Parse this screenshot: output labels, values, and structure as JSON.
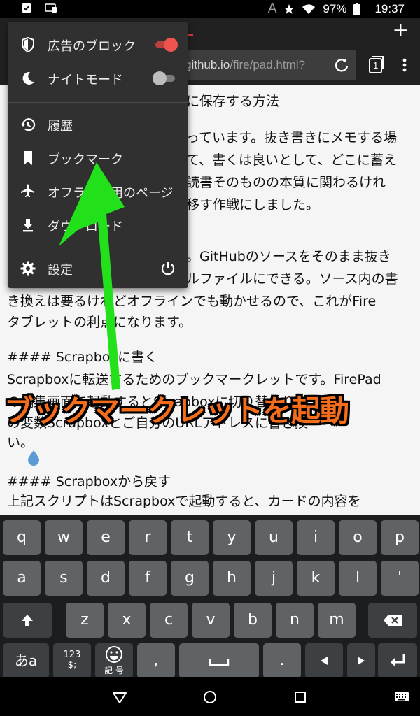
{
  "status": {
    "battery": "97%",
    "time": "19:37",
    "a_indicator": "A"
  },
  "browser": {
    "new_tab_label": "+",
    "url_main": "github.io",
    "url_path": "/fire/pad.html?",
    "tab_count": "1",
    "accent": "#e53935"
  },
  "menu": {
    "items": [
      {
        "label": "広告のブロック",
        "icon": "shield-icon",
        "toggle": "on"
      },
      {
        "label": "ナイトモード",
        "icon": "moon-icon",
        "toggle": "off"
      },
      {
        "label": "履歴",
        "icon": "history-icon"
      },
      {
        "label": "ブックマーク",
        "icon": "bookmark-icon"
      },
      {
        "label": "オフライン用のページ",
        "icon": "airplane-icon"
      },
      {
        "label": "ダウンロード",
        "icon": "download-icon"
      },
      {
        "label": "設定",
        "icon": "gear-icon"
      }
    ],
    "toggle_on_color": "#ef5350"
  },
  "page": {
    "lines": [
      "に保存する方法",
      "っています。抜き書きにメモする場",
      "て、書くは良いとして、どこに蓄え",
      "読書そのものの本質に関わるけれ",
      "移す作戦にしました。",
      "。GitHubのソースをそのまま抜き",
      "ルファイルにできる。ソース内の書",
      "き換えは要るけれどオフラインでも動かせるので、これがFire",
      "タブレットの利点になります。",
      "#### Scrapboxに書く",
      "Scrapboxに転送するためのブックマークレットです。FirePad",
      "の編集画面で起動するとScrapboxに切り替わり",
      "の変数Scrapboxとご自分のURLアドレスに書き換",
      "い。",
      "#### Scrapboxから戻す",
      "上記スクリプトはScrapboxで起動すると、カードの内容を"
    ]
  },
  "annotation": {
    "text": "ブックマークレットを起動",
    "arrow_color": "#22e11b"
  },
  "keyboard": {
    "row1": [
      "q",
      "w",
      "e",
      "r",
      "t",
      "y",
      "u",
      "i",
      "o",
      "p"
    ],
    "row2": [
      "a",
      "s",
      "d",
      "f",
      "g",
      "h",
      "j",
      "k",
      "l",
      "'"
    ],
    "row3": [
      "z",
      "x",
      "c",
      "v",
      "b",
      "n",
      "m"
    ],
    "row4": {
      "lang": "あa",
      "num_top": "123",
      "num_bottom": "$;",
      "emoji_label": "記 号",
      "comma": ",",
      "period": "."
    }
  }
}
